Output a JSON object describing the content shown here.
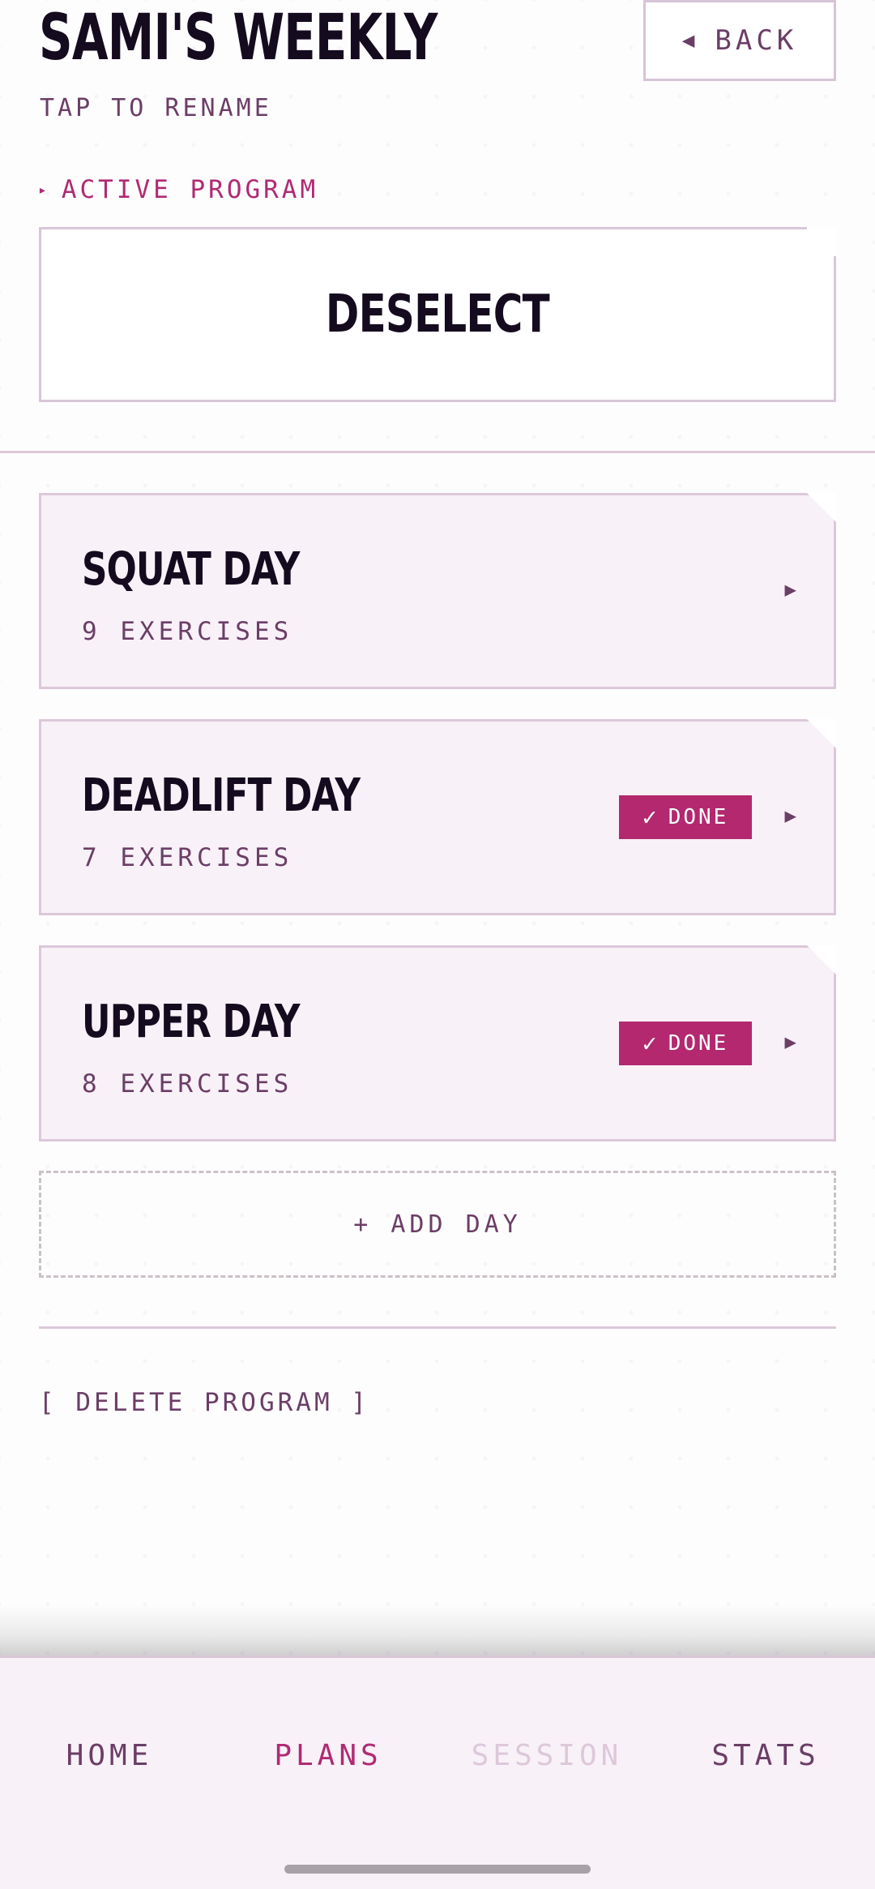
{
  "header": {
    "title": "SAMI'S WEEKLY",
    "subtitle": "TAP TO RENAME",
    "back_arrow": "◀",
    "back_label": "BACK"
  },
  "active_program": {
    "section_marker": "▸",
    "section_label": "ACTIVE PROGRAM",
    "deselect_label": "DESELECT"
  },
  "days": [
    {
      "name": "SQUAT DAY",
      "count": "9 EXERCISES",
      "done": false,
      "chevron": "▶"
    },
    {
      "name": "DEADLIFT DAY",
      "count": "7 EXERCISES",
      "done": true,
      "done_check": "✓",
      "done_label": "DONE",
      "chevron": "▶"
    },
    {
      "name": "UPPER DAY",
      "count": "8 EXERCISES",
      "done": true,
      "done_check": "✓",
      "done_label": "DONE",
      "chevron": "▶"
    }
  ],
  "add_day_label": "+ ADD DAY",
  "delete_program_label": "[ DELETE PROGRAM ]",
  "nav": {
    "items": [
      {
        "label": "HOME",
        "state": "normal"
      },
      {
        "label": "PLANS",
        "state": "active"
      },
      {
        "label": "SESSION",
        "state": "disabled"
      },
      {
        "label": "STATS",
        "state": "normal"
      }
    ]
  },
  "colors": {
    "accent": "#b3286f",
    "muted_text": "#6b3e66",
    "card_background": "#f8f1f8",
    "card_border": "#dcc8da",
    "heading_text": "#150b1f",
    "disabled_text": "#ddc8da"
  }
}
